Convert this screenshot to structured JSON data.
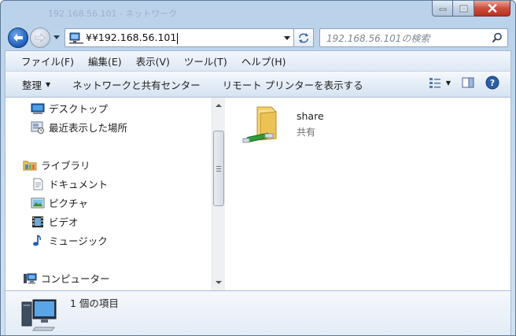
{
  "window": {
    "ghost_title": "192.168.56.101 - ネットワーク"
  },
  "address_bar": {
    "path": "¥¥192.168.56.101"
  },
  "search": {
    "placeholder": "192.168.56.101の検索"
  },
  "menu": {
    "items": [
      "ファイル(F)",
      "編集(E)",
      "表示(V)",
      "ツール(T)",
      "ヘルプ(H)"
    ]
  },
  "command_bar": {
    "organize": "整理",
    "network_center": "ネットワークと共有センター",
    "remote_printers": "リモート プリンターを表示する"
  },
  "nav_pane": {
    "favorites": [
      {
        "label": "デスクトップ",
        "icon": "desktop-icon"
      },
      {
        "label": "最近表示した場所",
        "icon": "recent-places-icon"
      }
    ],
    "libraries_header": {
      "label": "ライブラリ",
      "icon": "library-folder-icon"
    },
    "libraries": [
      {
        "label": "ドキュメント",
        "icon": "document-icon"
      },
      {
        "label": "ピクチャ",
        "icon": "picture-icon"
      },
      {
        "label": "ビデオ",
        "icon": "video-icon"
      },
      {
        "label": "ミュージック",
        "icon": "music-icon"
      }
    ],
    "computer": {
      "label": "コンピューター",
      "icon": "computer-icon"
    }
  },
  "content": {
    "items": [
      {
        "name": "share",
        "type": "共有",
        "icon": "shared-folder-icon"
      }
    ]
  },
  "details": {
    "count_text": "1 個の項目"
  }
}
